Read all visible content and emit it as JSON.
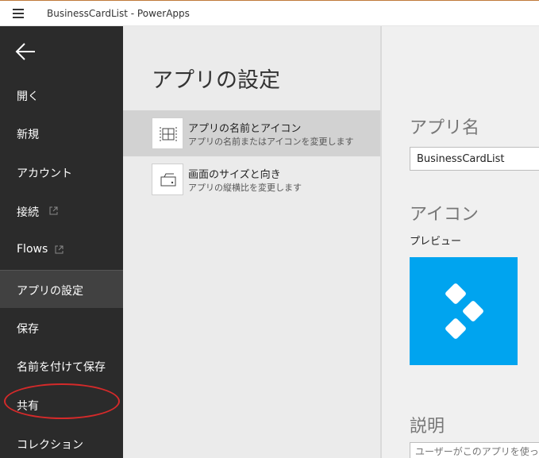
{
  "window": {
    "title": "BusinessCardList - PowerApps"
  },
  "sidebar": {
    "items": [
      {
        "label": "開く"
      },
      {
        "label": "新規"
      },
      {
        "label": "アカウント"
      },
      {
        "label": "接続"
      },
      {
        "label": "Flows"
      },
      {
        "label": "アプリの設定"
      },
      {
        "label": "保存"
      },
      {
        "label": "名前を付けて保存"
      },
      {
        "label": "共有"
      },
      {
        "label": "コレクション"
      }
    ],
    "active_item": "アプリの設定"
  },
  "main": {
    "heading": "アプリの設定",
    "options": [
      {
        "title": "アプリの名前とアイコン",
        "desc": "アプリの名前またはアイコンを変更します"
      },
      {
        "title": "画面のサイズと向き",
        "desc": "アプリの縦横比を変更します"
      }
    ]
  },
  "details": {
    "app_name_title": "アプリ名",
    "app_name_value": "BusinessCardList",
    "icon_title": "アイコン",
    "preview_label": "プレビュー",
    "description_title": "説明",
    "description_placeholder": "ユーザーがこのアプリを使っ"
  },
  "colors": {
    "sidebar_bg": "#2b2b2b",
    "sidebar_active": "#414141",
    "content_bg": "#ebebeb",
    "selected_option": "#d2d2d2",
    "icon_tile": "#00a4ef",
    "annotation_circle": "#d42a2a"
  },
  "icons": {
    "menu": "hamburger-icon",
    "back": "back-arrow-icon",
    "external": "external-link-icon",
    "option1": "app-name-icon",
    "option2": "screen-size-icon",
    "app": "app-diamond-icon"
  }
}
